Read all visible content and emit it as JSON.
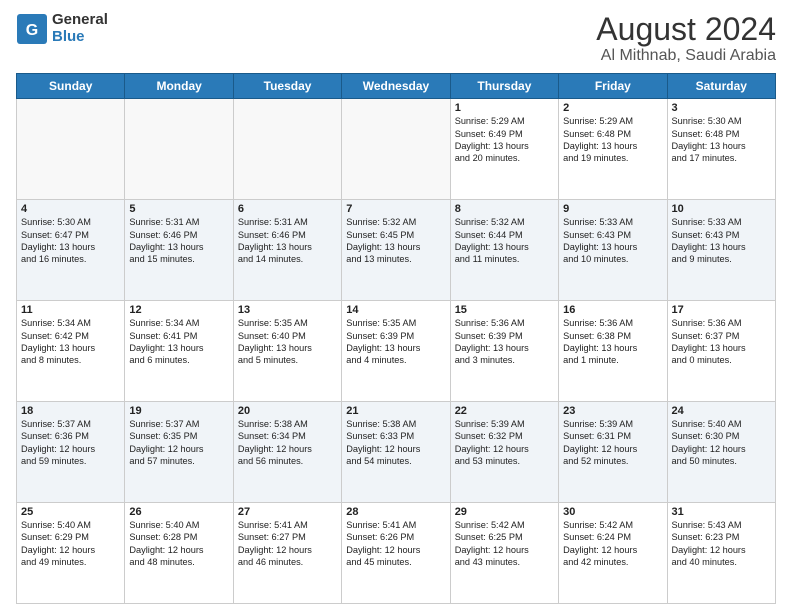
{
  "header": {
    "logo_line1": "General",
    "logo_line2": "Blue",
    "title": "August 2024",
    "subtitle": "Al Mithnab, Saudi Arabia"
  },
  "weekdays": [
    "Sunday",
    "Monday",
    "Tuesday",
    "Wednesday",
    "Thursday",
    "Friday",
    "Saturday"
  ],
  "weeks": [
    [
      {
        "day": "",
        "info": ""
      },
      {
        "day": "",
        "info": ""
      },
      {
        "day": "",
        "info": ""
      },
      {
        "day": "",
        "info": ""
      },
      {
        "day": "1",
        "info": "Sunrise: 5:29 AM\nSunset: 6:49 PM\nDaylight: 13 hours\nand 20 minutes."
      },
      {
        "day": "2",
        "info": "Sunrise: 5:29 AM\nSunset: 6:48 PM\nDaylight: 13 hours\nand 19 minutes."
      },
      {
        "day": "3",
        "info": "Sunrise: 5:30 AM\nSunset: 6:48 PM\nDaylight: 13 hours\nand 17 minutes."
      }
    ],
    [
      {
        "day": "4",
        "info": "Sunrise: 5:30 AM\nSunset: 6:47 PM\nDaylight: 13 hours\nand 16 minutes."
      },
      {
        "day": "5",
        "info": "Sunrise: 5:31 AM\nSunset: 6:46 PM\nDaylight: 13 hours\nand 15 minutes."
      },
      {
        "day": "6",
        "info": "Sunrise: 5:31 AM\nSunset: 6:46 PM\nDaylight: 13 hours\nand 14 minutes."
      },
      {
        "day": "7",
        "info": "Sunrise: 5:32 AM\nSunset: 6:45 PM\nDaylight: 13 hours\nand 13 minutes."
      },
      {
        "day": "8",
        "info": "Sunrise: 5:32 AM\nSunset: 6:44 PM\nDaylight: 13 hours\nand 11 minutes."
      },
      {
        "day": "9",
        "info": "Sunrise: 5:33 AM\nSunset: 6:43 PM\nDaylight: 13 hours\nand 10 minutes."
      },
      {
        "day": "10",
        "info": "Sunrise: 5:33 AM\nSunset: 6:43 PM\nDaylight: 13 hours\nand 9 minutes."
      }
    ],
    [
      {
        "day": "11",
        "info": "Sunrise: 5:34 AM\nSunset: 6:42 PM\nDaylight: 13 hours\nand 8 minutes."
      },
      {
        "day": "12",
        "info": "Sunrise: 5:34 AM\nSunset: 6:41 PM\nDaylight: 13 hours\nand 6 minutes."
      },
      {
        "day": "13",
        "info": "Sunrise: 5:35 AM\nSunset: 6:40 PM\nDaylight: 13 hours\nand 5 minutes."
      },
      {
        "day": "14",
        "info": "Sunrise: 5:35 AM\nSunset: 6:39 PM\nDaylight: 13 hours\nand 4 minutes."
      },
      {
        "day": "15",
        "info": "Sunrise: 5:36 AM\nSunset: 6:39 PM\nDaylight: 13 hours\nand 3 minutes."
      },
      {
        "day": "16",
        "info": "Sunrise: 5:36 AM\nSunset: 6:38 PM\nDaylight: 13 hours\nand 1 minute."
      },
      {
        "day": "17",
        "info": "Sunrise: 5:36 AM\nSunset: 6:37 PM\nDaylight: 13 hours\nand 0 minutes."
      }
    ],
    [
      {
        "day": "18",
        "info": "Sunrise: 5:37 AM\nSunset: 6:36 PM\nDaylight: 12 hours\nand 59 minutes."
      },
      {
        "day": "19",
        "info": "Sunrise: 5:37 AM\nSunset: 6:35 PM\nDaylight: 12 hours\nand 57 minutes."
      },
      {
        "day": "20",
        "info": "Sunrise: 5:38 AM\nSunset: 6:34 PM\nDaylight: 12 hours\nand 56 minutes."
      },
      {
        "day": "21",
        "info": "Sunrise: 5:38 AM\nSunset: 6:33 PM\nDaylight: 12 hours\nand 54 minutes."
      },
      {
        "day": "22",
        "info": "Sunrise: 5:39 AM\nSunset: 6:32 PM\nDaylight: 12 hours\nand 53 minutes."
      },
      {
        "day": "23",
        "info": "Sunrise: 5:39 AM\nSunset: 6:31 PM\nDaylight: 12 hours\nand 52 minutes."
      },
      {
        "day": "24",
        "info": "Sunrise: 5:40 AM\nSunset: 6:30 PM\nDaylight: 12 hours\nand 50 minutes."
      }
    ],
    [
      {
        "day": "25",
        "info": "Sunrise: 5:40 AM\nSunset: 6:29 PM\nDaylight: 12 hours\nand 49 minutes."
      },
      {
        "day": "26",
        "info": "Sunrise: 5:40 AM\nSunset: 6:28 PM\nDaylight: 12 hours\nand 48 minutes."
      },
      {
        "day": "27",
        "info": "Sunrise: 5:41 AM\nSunset: 6:27 PM\nDaylight: 12 hours\nand 46 minutes."
      },
      {
        "day": "28",
        "info": "Sunrise: 5:41 AM\nSunset: 6:26 PM\nDaylight: 12 hours\nand 45 minutes."
      },
      {
        "day": "29",
        "info": "Sunrise: 5:42 AM\nSunset: 6:25 PM\nDaylight: 12 hours\nand 43 minutes."
      },
      {
        "day": "30",
        "info": "Sunrise: 5:42 AM\nSunset: 6:24 PM\nDaylight: 12 hours\nand 42 minutes."
      },
      {
        "day": "31",
        "info": "Sunrise: 5:43 AM\nSunset: 6:23 PM\nDaylight: 12 hours\nand 40 minutes."
      }
    ]
  ]
}
